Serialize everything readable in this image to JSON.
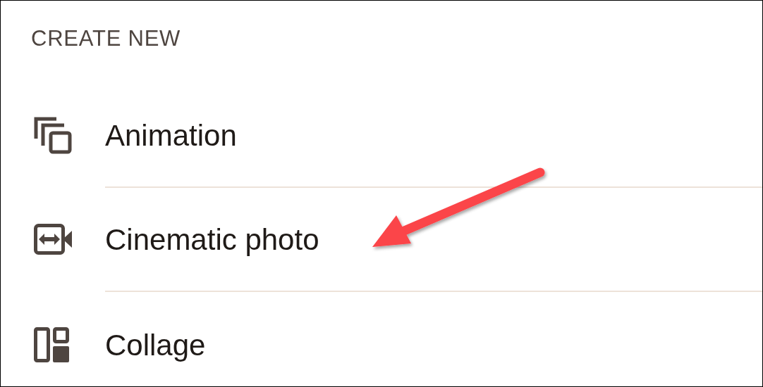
{
  "section_title": "CREATE NEW",
  "items": [
    {
      "kind": "animation",
      "label": "Animation"
    },
    {
      "kind": "cinematic",
      "label": "Cinematic photo"
    },
    {
      "kind": "collage",
      "label": "Collage"
    }
  ]
}
